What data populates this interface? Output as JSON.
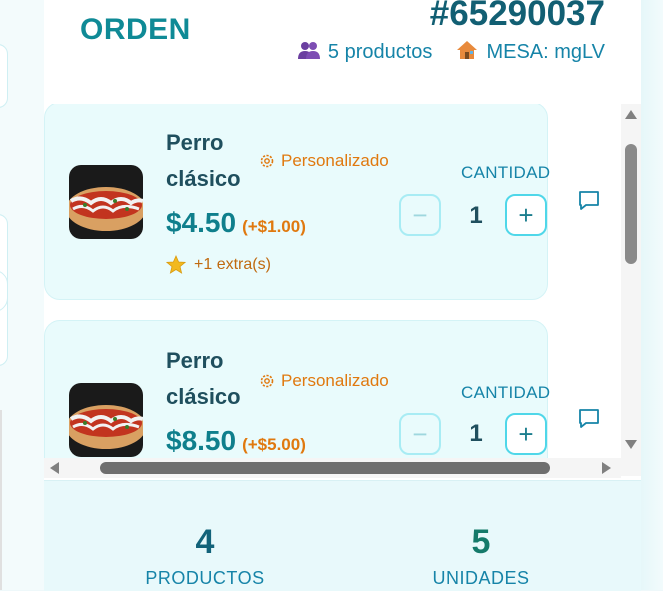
{
  "header": {
    "title": "ORDEN",
    "order_number": "#65290037",
    "products_count": "5 productos",
    "table_label": "MESA: mgLV"
  },
  "items": [
    {
      "name_line1": "Perro",
      "name_line2": "clásico",
      "custom_tag": "Personalizado",
      "price": "$4.50",
      "price_extra": "(+$1.00)",
      "extras": "+1 extra(s)",
      "qty_label": "CANTIDAD",
      "quantity": "1",
      "minus": "−",
      "plus": "+"
    },
    {
      "name_line1": "Perro",
      "name_line2": "clásico",
      "custom_tag": "Personalizado",
      "price": "$8.50",
      "price_extra": "(+$5.00)",
      "qty_label": "CANTIDAD",
      "quantity": "1",
      "minus": "−",
      "plus": "+"
    }
  ],
  "summary": {
    "products_value": "4",
    "products_label": "PRODUCTOS",
    "units_value": "5",
    "units_label": "UNIDADES"
  },
  "icons": {
    "people": "people-icon",
    "house": "house-icon",
    "gear": "gear-icon",
    "star": "star-icon",
    "comment": "comment-icon"
  },
  "colors": {
    "accent": "#0f8a96",
    "orange": "#e0790f",
    "card_bg": "#e9fbfc"
  }
}
